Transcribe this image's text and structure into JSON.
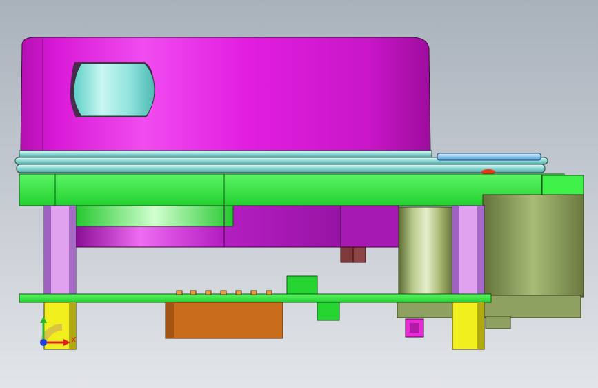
{
  "viewport": {
    "background_top": "#a9b1bb",
    "background_bottom": "#e2e5e9"
  },
  "axis_triad": {
    "x_label": "X",
    "x_color": "#e0201c",
    "y_color": "#2fb52f",
    "z_color": "#1e3fd8"
  },
  "colors": {
    "housing": "#e21ee1",
    "board": "#2ee83a",
    "board_dark": "#1fa92c",
    "ring": "#a6e6e3",
    "standoff": "#e0a2ee",
    "spacer": "#f2ef1e",
    "motor": "#9bb06a",
    "connector": "#c96d1c",
    "purple_body": "#b51ec2",
    "small_part": "#ea2ad6"
  }
}
